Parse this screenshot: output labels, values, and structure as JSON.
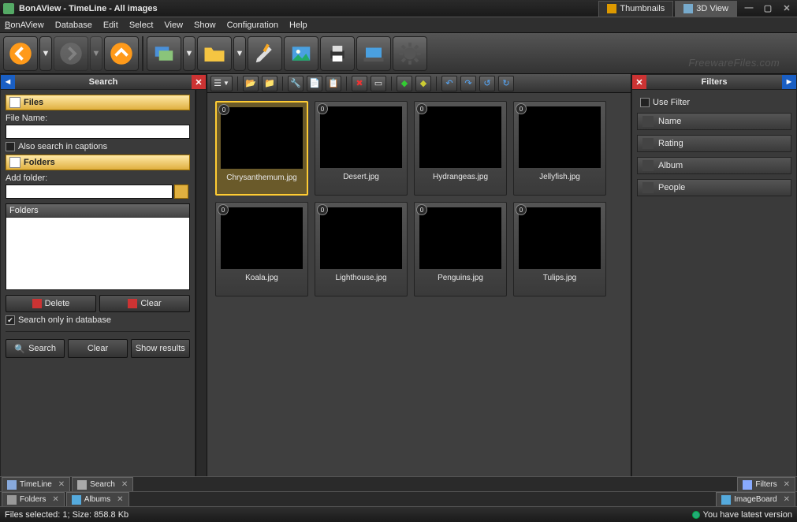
{
  "window": {
    "title": "BonAView - TimeLine - All images"
  },
  "view_tabs": {
    "thumbnails": "Thumbnails",
    "view3d": "3D View"
  },
  "menu": {
    "bonaview": "BonAView",
    "database": "Database",
    "edit": "Edit",
    "select": "Select",
    "view": "View",
    "show": "Show",
    "configuration": "Configuration",
    "help": "Help"
  },
  "toolbar_icons": [
    "back",
    "back-dd",
    "forward",
    "forward-dd",
    "up",
    "sep",
    "slideshow",
    "slideshow-dd",
    "folder",
    "folder-dd",
    "edit-tools",
    "image-adjust",
    "print",
    "scan",
    "gear"
  ],
  "search_panel": {
    "title": "Search",
    "files_section": "Files",
    "filename_label": "File Name:",
    "filename_value": "",
    "also_captions": "Also search in captions",
    "folders_section": "Folders",
    "addfolder_label": "Add folder:",
    "addfolder_value": "",
    "folders_header": "Folders",
    "delete_btn": "Delete",
    "clear_btn": "Clear",
    "search_only_db": "Search only in database",
    "search_btn": "Search",
    "clear2_btn": "Clear",
    "show_results_btn": "Show results"
  },
  "center_toolbar_icons": [
    "view-mode",
    "dd",
    "sep",
    "open",
    "open-loc",
    "sep",
    "tools",
    "copy",
    "paste",
    "sep",
    "delete",
    "rename",
    "sep",
    "tag-green",
    "tag-yellow",
    "sep",
    "undo",
    "redo",
    "rotate-left",
    "rotate-right"
  ],
  "thumbnails": [
    {
      "name": "Chrysanthemum.jpg",
      "selected": true,
      "klass": "t0"
    },
    {
      "name": "Desert.jpg",
      "selected": false,
      "klass": "t1"
    },
    {
      "name": "Hydrangeas.jpg",
      "selected": false,
      "klass": "t2"
    },
    {
      "name": "Jellyfish.jpg",
      "selected": false,
      "klass": "t3"
    },
    {
      "name": "Koala.jpg",
      "selected": false,
      "klass": "t4"
    },
    {
      "name": "Lighthouse.jpg",
      "selected": false,
      "klass": "t5"
    },
    {
      "name": "Penguins.jpg",
      "selected": false,
      "klass": "t6"
    },
    {
      "name": "Tulips.jpg",
      "selected": false,
      "klass": "t7"
    }
  ],
  "filters_panel": {
    "title": "Filters",
    "use_filter": "Use Filter",
    "cats": {
      "name": "Name",
      "rating": "Rating",
      "album": "Album",
      "people": "People"
    }
  },
  "bottom_tabs_left": [
    {
      "icon": "timeline",
      "label": "TimeLine"
    },
    {
      "icon": "search",
      "label": "Search"
    },
    {
      "icon": "folders",
      "label": "Folders"
    },
    {
      "icon": "albums",
      "label": "Albums"
    }
  ],
  "bottom_tabs_right": [
    {
      "icon": "filters",
      "label": "Filters"
    },
    {
      "icon": "imageboard",
      "label": "ImageBoard"
    }
  ],
  "status": {
    "left": "Files selected: 1; Size: 858.8 Kb",
    "right": "You have latest version"
  },
  "watermark": "FreewareFiles.com"
}
